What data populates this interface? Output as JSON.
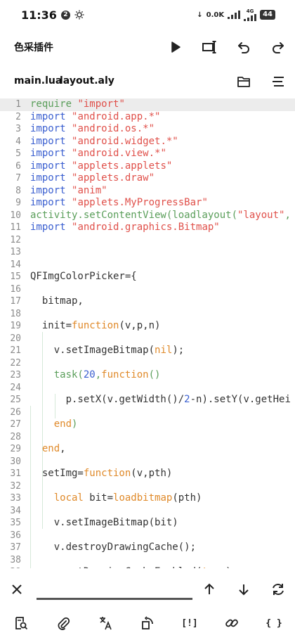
{
  "status": {
    "time": "11:36",
    "notif_count": "2",
    "net_speed": "0.0K",
    "net_type": "4G",
    "battery": "44"
  },
  "app": {
    "title": "色采插件"
  },
  "toolbar_icons": [
    "run-icon",
    "format-icon",
    "undo-icon",
    "redo-icon"
  ],
  "files": {
    "tab1": "main.lua",
    "tab2": "layout.aly"
  },
  "filebar_icons": [
    "folder-icon",
    "menu-icon"
  ],
  "code": {
    "current_line": 1,
    "lines": [
      [
        [
          "require ",
          "#5a9e5a"
        ],
        [
          "\"import\"",
          "#e0504a"
        ]
      ],
      [
        [
          "import ",
          "#3a5fd0"
        ],
        [
          "\"android.app.*\"",
          "#e0504a"
        ]
      ],
      [
        [
          "import ",
          "#3a5fd0"
        ],
        [
          "\"android.os.*\"",
          "#e0504a"
        ]
      ],
      [
        [
          "import ",
          "#3a5fd0"
        ],
        [
          "\"android.widget.*\"",
          "#e0504a"
        ]
      ],
      [
        [
          "import ",
          "#3a5fd0"
        ],
        [
          "\"android.view.*\"",
          "#e0504a"
        ]
      ],
      [
        [
          "import ",
          "#3a5fd0"
        ],
        [
          "\"applets.applets\"",
          "#e0504a"
        ]
      ],
      [
        [
          "import ",
          "#3a5fd0"
        ],
        [
          "\"applets.draw\"",
          "#e0504a"
        ]
      ],
      [
        [
          "import ",
          "#3a5fd0"
        ],
        [
          "\"anim\"",
          "#e0504a"
        ]
      ],
      [
        [
          "import ",
          "#3a5fd0"
        ],
        [
          "\"applets.MyProgressBar\"",
          "#e0504a"
        ]
      ],
      [
        [
          "activity.setContentView(loadlayout(",
          "#5a9e5a"
        ],
        [
          "\"layout\"",
          "#e0504a"
        ],
        [
          ",",
          "#5a9e5a"
        ]
      ],
      [
        [
          "import ",
          "#3a5fd0"
        ],
        [
          "\"android.graphics.Bitmap\"",
          "#e0504a"
        ]
      ],
      [],
      [],
      [],
      [
        [
          "QFImgColorPicker={",
          "#333333"
        ]
      ],
      [],
      [
        [
          "  bitmap,",
          "#333333"
        ]
      ],
      [],
      [
        [
          "  init=",
          "#333333"
        ],
        [
          "function",
          "#e08a2a"
        ],
        [
          "(v,p,n)",
          "#333333"
        ]
      ],
      [],
      [
        [
          "    v.setImageBitmap(",
          "#333333"
        ],
        [
          "nil",
          "#e08a2a"
        ],
        [
          ");",
          "#333333"
        ]
      ],
      [],
      [
        [
          "    task(",
          "#5a9e5a"
        ],
        [
          "20",
          "#3a5fd0"
        ],
        [
          ",",
          "#5a9e5a"
        ],
        [
          "function",
          "#e08a2a"
        ],
        [
          "()",
          "#5a9e5a"
        ]
      ],
      [],
      [
        [
          "      p.setX(v.getWidth()/",
          "#333333"
        ],
        [
          "2",
          "#3a5fd0"
        ],
        [
          "-n).setY(v.getHei",
          "#333333"
        ]
      ],
      [],
      [
        [
          "    end",
          "#e08a2a"
        ],
        [
          ")",
          "#5a9e5a"
        ]
      ],
      [],
      [
        [
          "  end",
          "#e08a2a"
        ],
        [
          ",",
          "#333333"
        ]
      ],
      [],
      [
        [
          "  setImg=",
          "#333333"
        ],
        [
          "function",
          "#e08a2a"
        ],
        [
          "(v,pth)",
          "#333333"
        ]
      ],
      [],
      [
        [
          "    local",
          "#e08a2a"
        ],
        [
          " bit=",
          "#333333"
        ],
        [
          "loadbitmap",
          "#e08a2a"
        ],
        [
          "(pth)",
          "#333333"
        ]
      ],
      [],
      [
        [
          "    v.setImageBitmap(bit)",
          "#333333"
        ]
      ],
      [],
      [
        [
          "    v.destroyDrawingCache();",
          "#333333"
        ]
      ],
      [],
      [
        [
          "    v.setDrawingCacheEnabled(",
          "#333333"
        ],
        [
          "true",
          "#e08a2a"
        ],
        [
          ");",
          "#333333"
        ]
      ]
    ]
  },
  "find": {
    "placeholder": ""
  },
  "find_icons": [
    "close-icon",
    "arrow-up-icon",
    "arrow-down-icon",
    "replace-icon"
  ],
  "bottom_icons": [
    {
      "name": "search-file-icon",
      "text": ""
    },
    {
      "name": "paperclip-icon",
      "text": ""
    },
    {
      "name": "translate-icon",
      "text": ""
    },
    {
      "name": "rotate-icon",
      "text": ""
    },
    {
      "name": "bracket-bang-icon",
      "text": "[!]"
    },
    {
      "name": "link-icon",
      "text": ""
    },
    {
      "name": "braces-icon",
      "text": "{ }"
    }
  ]
}
